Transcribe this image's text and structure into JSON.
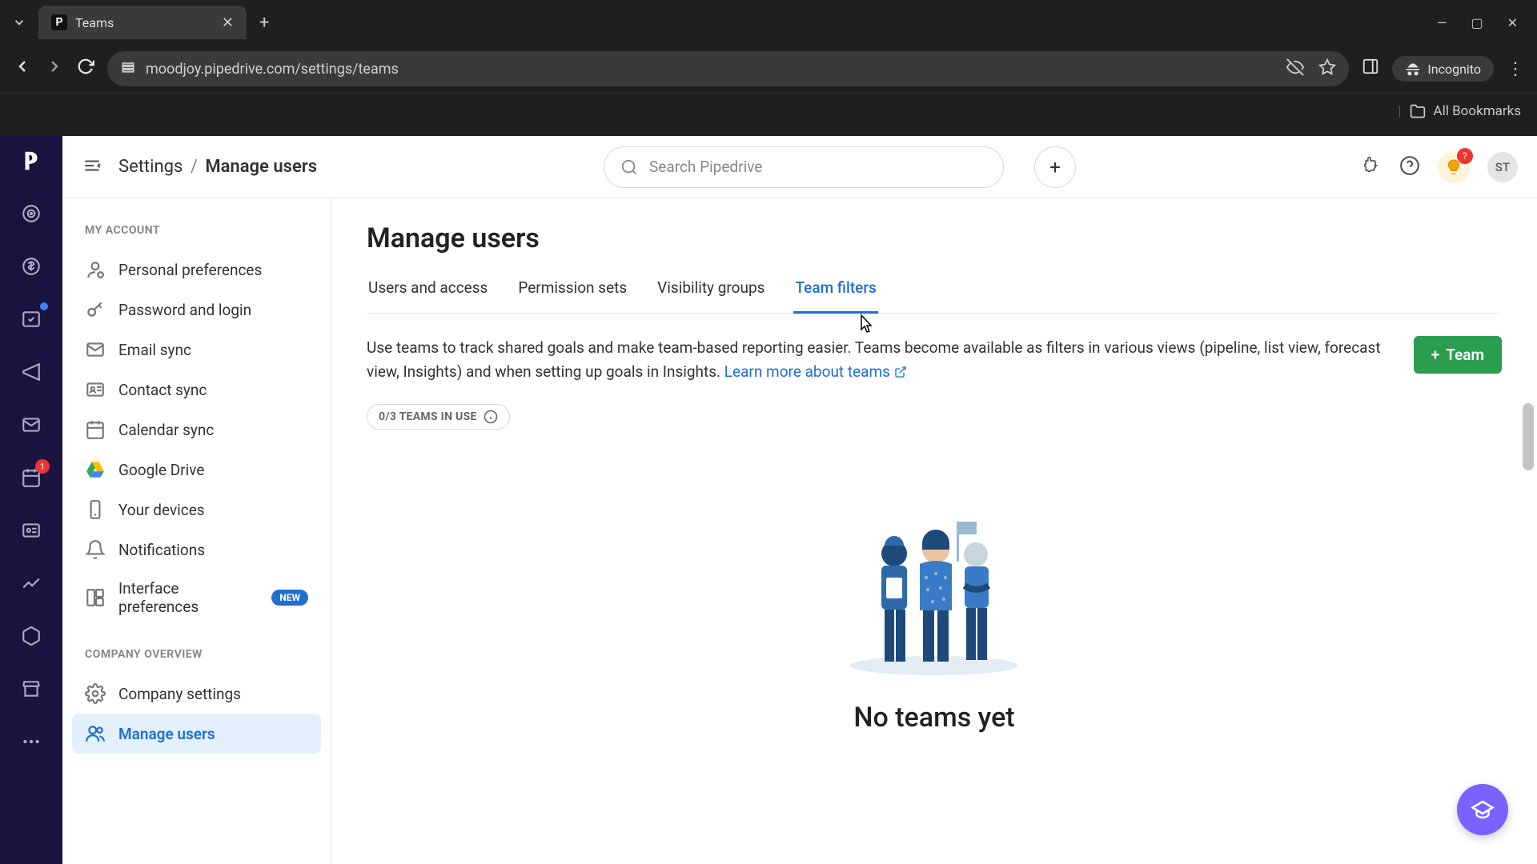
{
  "browser": {
    "tab_title": "Teams",
    "tab_favicon_letter": "P",
    "url": "moodjoy.pipedrive.com/settings/teams",
    "incognito_label": "Incognito",
    "bookmarks_label": "All Bookmarks"
  },
  "header": {
    "breadcrumb_root": "Settings",
    "breadcrumb_current": "Manage users",
    "search_placeholder": "Search Pipedrive",
    "avatar_initials": "ST",
    "bulb_badge": "?"
  },
  "rail": {
    "leads_badge": "1"
  },
  "sidebar": {
    "section_account": "MY ACCOUNT",
    "section_company": "COMPANY OVERVIEW",
    "items_account": [
      "Personal preferences",
      "Password and login",
      "Email sync",
      "Contact sync",
      "Calendar sync",
      "Google Drive",
      "Your devices",
      "Notifications",
      "Interface preferences"
    ],
    "new_badge": "NEW",
    "items_company": [
      "Company settings",
      "Manage users"
    ]
  },
  "content": {
    "title": "Manage users",
    "tabs": [
      "Users and access",
      "Permission sets",
      "Visibility groups",
      "Team filters"
    ],
    "description": "Use teams to track shared goals and make team-based reporting easier. Teams become available as filters in various views (pipeline, list view, forecast view, Insights) and when setting up goals in Insights. ",
    "learn_more": "Learn more about teams",
    "team_button": "Team",
    "usage_label": "0/3 TEAMS IN USE",
    "empty_title": "No teams yet"
  }
}
